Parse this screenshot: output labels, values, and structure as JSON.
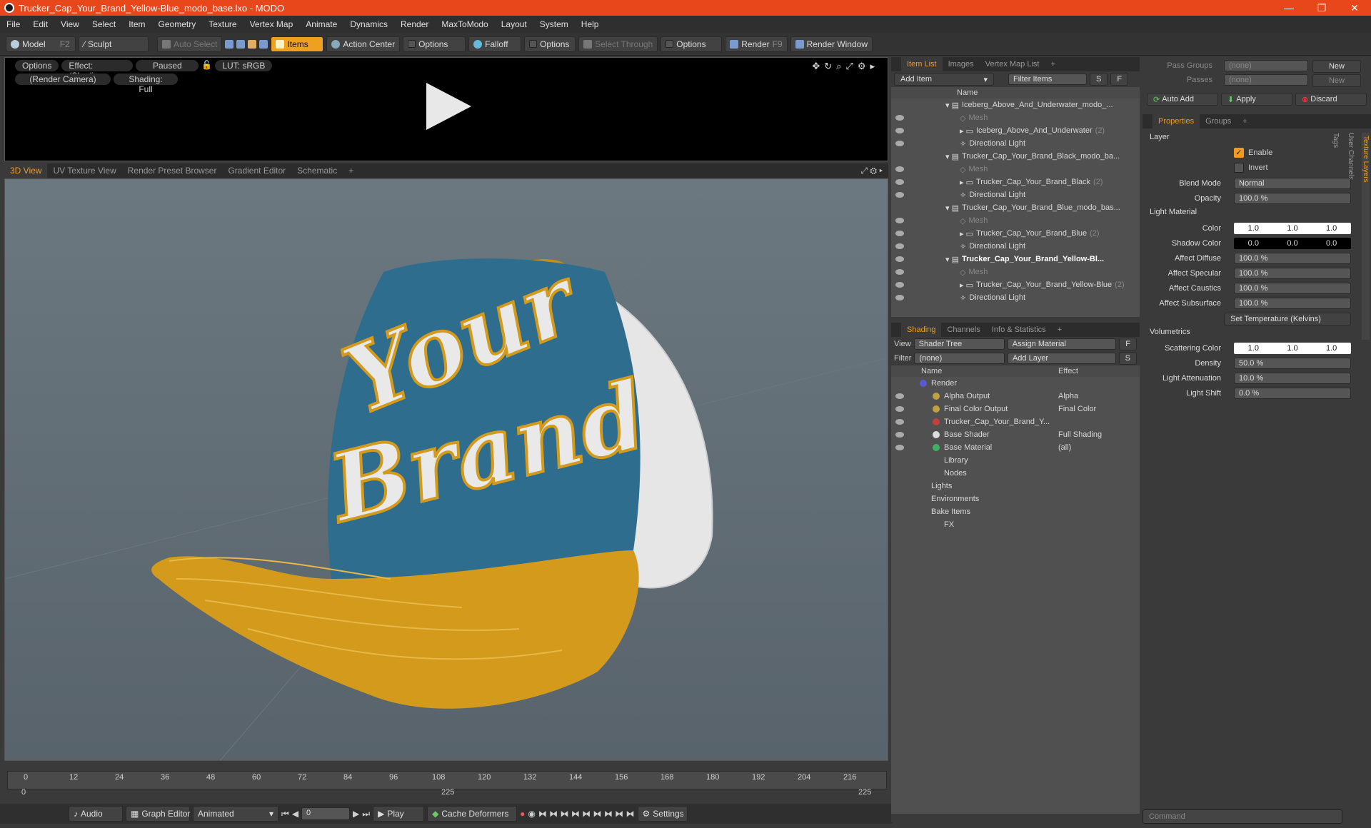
{
  "window": {
    "title": "Trucker_Cap_Your_Brand_Yellow-Blue_modo_base.lxo - MODO",
    "min": "—",
    "max": "❐",
    "close": "✕"
  },
  "menu": [
    "File",
    "Edit",
    "View",
    "Select",
    "Item",
    "Geometry",
    "Texture",
    "Vertex Map",
    "Animate",
    "Dynamics",
    "Render",
    "MaxToModo",
    "Layout",
    "System",
    "Help"
  ],
  "toolbar": {
    "model": "Model",
    "model_key": "F2",
    "sculpt": "Sculpt",
    "auto_select": "Auto Select",
    "items": "Items",
    "action_center": "Action Center",
    "options1": "Options",
    "falloff": "Falloff",
    "options2": "Options",
    "select_through": "Select Through",
    "options3": "Options",
    "render": "Render",
    "render_key": "F9",
    "render_window": "Render Window"
  },
  "preview": {
    "options": "Options",
    "effect": "Effect: (Shadi...",
    "paused": "Paused",
    "lut": "LUT: sRGB",
    "camera": "(Render Camera)",
    "shading": "Shading: Full"
  },
  "viewport_tabs": [
    "3D View",
    "UV Texture View",
    "Render Preset Browser",
    "Gradient Editor",
    "Schematic",
    "+"
  ],
  "cap_text": {
    "line1": "Your",
    "line2": "Brand"
  },
  "timeline": {
    "ticks": [
      "0",
      "12",
      "24",
      "36",
      "48",
      "60",
      "72",
      "84",
      "96",
      "108",
      "120",
      "132",
      "144",
      "156",
      "168",
      "180",
      "192",
      "204",
      "216"
    ],
    "bottom": [
      "0",
      "225",
      "225"
    ]
  },
  "transport": {
    "audio": "Audio",
    "graph_editor": "Graph Editor",
    "animated": "Animated",
    "frame": "0",
    "play": "Play",
    "cache": "Cache Deformers",
    "settings": "Settings"
  },
  "item_list": {
    "tabs": [
      "Item List",
      "Images",
      "Vertex Map List",
      "+"
    ],
    "add_item": "Add Item",
    "filter": "Filter Items",
    "s": "S",
    "f": "F",
    "name_header": "Name",
    "rows": [
      {
        "text": "Iceberg_Above_And_Underwater_modo_...",
        "indent": 1,
        "kind": "scene",
        "eye": false
      },
      {
        "text": "Mesh",
        "indent": 2,
        "kind": "mesh",
        "eye": true
      },
      {
        "text": "Iceberg_Above_And_Underwater",
        "extra": "(2)",
        "indent": 2,
        "kind": "group",
        "eye": true
      },
      {
        "text": "Directional Light",
        "indent": 2,
        "kind": "light",
        "eye": true
      },
      {
        "text": "Trucker_Cap_Your_Brand_Black_modo_ba...",
        "indent": 1,
        "kind": "scene",
        "eye": false
      },
      {
        "text": "Mesh",
        "indent": 2,
        "kind": "mesh",
        "eye": true
      },
      {
        "text": "Trucker_Cap_Your_Brand_Black",
        "extra": "(2)",
        "indent": 2,
        "kind": "group",
        "eye": true
      },
      {
        "text": "Directional Light",
        "indent": 2,
        "kind": "light",
        "eye": true
      },
      {
        "text": "Trucker_Cap_Your_Brand_Blue_modo_bas...",
        "indent": 1,
        "kind": "scene",
        "eye": false
      },
      {
        "text": "Mesh",
        "indent": 2,
        "kind": "mesh",
        "eye": true
      },
      {
        "text": "Trucker_Cap_Your_Brand_Blue",
        "extra": "(2)",
        "indent": 2,
        "kind": "group",
        "eye": true
      },
      {
        "text": "Directional Light",
        "indent": 2,
        "kind": "light",
        "eye": true
      },
      {
        "text": "Trucker_Cap_Your_Brand_Yellow-Bl...",
        "indent": 1,
        "kind": "scene",
        "eye": true,
        "bold": true
      },
      {
        "text": "Mesh",
        "indent": 2,
        "kind": "mesh",
        "eye": true
      },
      {
        "text": "Trucker_Cap_Your_Brand_Yellow-Blue",
        "extra": "(2)",
        "indent": 2,
        "kind": "group",
        "eye": true
      },
      {
        "text": "Directional Light",
        "indent": 2,
        "kind": "light",
        "eye": true
      }
    ]
  },
  "shading": {
    "tabs": [
      "Shading",
      "Channels",
      "Info & Statistics",
      "+"
    ],
    "view_label": "View",
    "view_value": "Shader Tree",
    "assign": "Assign Material",
    "f": "F",
    "filter_label": "Filter",
    "filter_value": "(none)",
    "add_layer": "Add Layer",
    "s": "S",
    "name_header": "Name",
    "effect_header": "Effect",
    "rows": [
      {
        "name": "Render",
        "effect": "",
        "indent": 1,
        "eye": false,
        "dot": "#5a5ad0"
      },
      {
        "name": "Alpha Output",
        "effect": "Alpha",
        "indent": 2,
        "eye": true,
        "dot": "#c0a040"
      },
      {
        "name": "Final Color Output",
        "effect": "Final Color",
        "indent": 2,
        "eye": true,
        "dot": "#c0a040"
      },
      {
        "name": "Trucker_Cap_Your_Brand_Y...",
        "effect": "",
        "indent": 2,
        "eye": true,
        "dot": "#c04040"
      },
      {
        "name": "Base Shader",
        "effect": "Full Shading",
        "indent": 2,
        "eye": true,
        "dot": "#ddd"
      },
      {
        "name": "Base Material",
        "effect": "(all)",
        "indent": 2,
        "eye": true,
        "dot": "#40b060"
      },
      {
        "name": "Library",
        "effect": "",
        "indent": 2,
        "eye": false,
        "dot": ""
      },
      {
        "name": "Nodes",
        "effect": "",
        "indent": 2,
        "eye": false,
        "dot": ""
      },
      {
        "name": "Lights",
        "effect": "",
        "indent": 1,
        "eye": false,
        "dot": ""
      },
      {
        "name": "Environments",
        "effect": "",
        "indent": 1,
        "eye": false,
        "dot": ""
      },
      {
        "name": "Bake Items",
        "effect": "",
        "indent": 1,
        "eye": false,
        "dot": ""
      },
      {
        "name": "FX",
        "effect": "",
        "indent": 2,
        "eye": false,
        "dot": ""
      }
    ]
  },
  "pass": {
    "groups_label": "Pass Groups",
    "groups_value": "(none)",
    "new": "New",
    "passes_label": "Passes",
    "passes_value": "(none)",
    "new2": "New",
    "auto_add": "Auto Add",
    "apply": "Apply",
    "discard": "Discard"
  },
  "properties": {
    "tabs": [
      "Properties",
      "Groups",
      "+"
    ],
    "side_tabs": [
      "Texture Layers",
      "User Channels",
      "Tags"
    ],
    "layer": "Layer",
    "enable": "Enable",
    "invert": "Invert",
    "blend_label": "Blend Mode",
    "blend": "Normal",
    "opacity_label": "Opacity",
    "opacity": "100.0 %",
    "light_material": "Light Material",
    "color_label": "Color",
    "color": [
      "1.0",
      "1.0",
      "1.0"
    ],
    "shadow_label": "Shadow Color",
    "shadow": [
      "0.0",
      "0.0",
      "0.0"
    ],
    "affect_diffuse_label": "Affect Diffuse",
    "affect_diffuse": "100.0 %",
    "affect_specular_label": "Affect Specular",
    "affect_specular": "100.0 %",
    "affect_caustics_label": "Affect Caustics",
    "affect_caustics": "100.0 %",
    "affect_subsurface_label": "Affect Subsurface",
    "affect_subsurface": "100.0 %",
    "set_temp": "Set Temperature (Kelvins)",
    "volumetrics": "Volumetrics",
    "scattering_label": "Scattering Color",
    "scattering": [
      "1.0",
      "1.0",
      "1.0"
    ],
    "density_label": "Density",
    "density": "50.0 %",
    "attenuation_label": "Light Attenuation",
    "attenuation": "10.0 %",
    "shift_label": "Light Shift",
    "shift": "0.0 %"
  },
  "command_placeholder": "Command",
  "colors": {
    "accent": "#f09a20",
    "titlebar": "#e8461b",
    "cap_blue": "#2e6d8e",
    "cap_yellow": "#d39a1c"
  }
}
